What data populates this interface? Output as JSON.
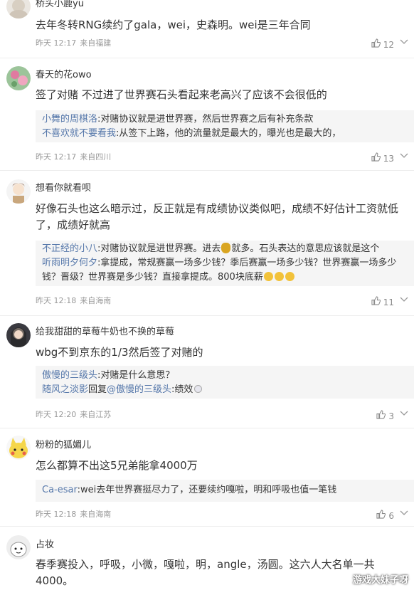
{
  "comments": [
    {
      "username": "桥头小鹿yu",
      "text": "去年冬转RNG续约了gala，wei，史森明。wei是三年合同",
      "time": "昨天 12:17",
      "location": "来自福建",
      "likes": "12"
    },
    {
      "username": "春天的花owo",
      "text": "签了对赌 不过进了世界赛石头看起来老高兴了应该不会很低的",
      "replies": [
        {
          "name": "小舞的周棋洛",
          "text": ":对赌协议就是进世界赛，然后世界赛之后有补充条款"
        },
        {
          "name": "不喜欢就不要看我",
          "text": ":从签下上路，他的流量就是最大的，曝光也是最大的，"
        }
      ],
      "time": "昨天 12:17",
      "location": "来自四川",
      "likes": "13"
    },
    {
      "username": "想看你就看呗",
      "text": "好像石头也这么暗示过，反正就是有成绩协议类似吧，成绩不好估计工资就低了，成绩好就高",
      "replies": [
        {
          "name": "不正经的小八",
          "text_a": ":对赌协议就是进世界赛。进去",
          "text_b": "就多。石头表达的意思应该就是这个"
        },
        {
          "name": "听雨明夕何夕",
          "text": ":拿提成，常规赛赢一场多少钱？季后赛赢一场多少钱？世界赛赢一场多少钱？晋级？世界赛是多少钱？直接拿提成。800块底薪"
        }
      ],
      "time": "昨天 12:18",
      "location": "来自海南",
      "likes": "11"
    },
    {
      "username": "给我甜甜的草莓牛奶也不换的草莓",
      "text": "wbg不到京东的1/3然后签了对赌的",
      "replies": [
        {
          "name": "傲慢的三级头",
          "text": ":对赌是什么意思？"
        },
        {
          "name": "随风之淡影",
          "mid": "回复",
          "name2": "@傲慢的三级头",
          "text": ":绩效"
        }
      ],
      "time": "昨天 12:20",
      "location": "来自江苏",
      "likes": "3"
    },
    {
      "username": "粉粉的狐媚儿",
      "text": "怎么都算不出这5兄弟能拿4000万",
      "replies": [
        {
          "name": "Ca-esar",
          "text": ":wei去年世界赛挺尽力了，还要续约嘎啦，明和呼吸也值一笔钱"
        }
      ],
      "time": "昨天 12:18",
      "location": "来自海南",
      "likes": "6"
    },
    {
      "username": "占妆",
      "text": "春季赛投入，呼吸，小微，嘎啦，明，angle，汤圆。这六人大名单一共4000。"
    }
  ],
  "icons": {
    "like": "thumbs-up-icon",
    "more": "more-icon"
  },
  "watermark": "游戏大妹子呀",
  "colors": {
    "reply_name": "#5577aa",
    "meta": "#999999",
    "reply_bg": "#f5f5f5"
  }
}
